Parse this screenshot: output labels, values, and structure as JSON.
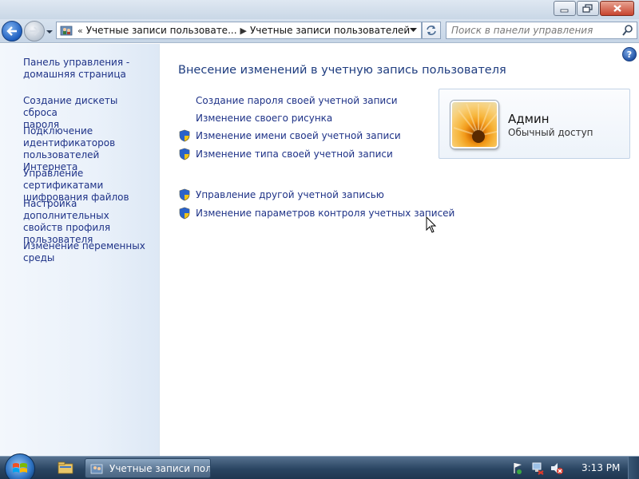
{
  "window": {
    "min_label": "",
    "breadcrumb_lead": "«",
    "breadcrumb": [
      "Учетные записи пользовате...",
      "Учетные записи пользователей"
    ],
    "breadcrumb_sep": "▶",
    "search_placeholder": "Поиск в панели управления"
  },
  "sidebar": {
    "items": [
      "Панель управления -\nдомашняя страница",
      "Создание дискеты сброса\nпароля",
      "Подключение\nидентификаторов\nпользователей Интернета",
      "Управление сертификатами\nшифрования файлов",
      "Настройка дополнительных\nсвойств профиля\nпользователя",
      "Изменение переменных\nсреды"
    ]
  },
  "main": {
    "title": "Внесение изменений в учетную запись пользователя",
    "help": "?",
    "tasks": [
      {
        "label": "Создание пароля своей учетной записи",
        "shield": false
      },
      {
        "label": "Изменение своего рисунка",
        "shield": false
      },
      {
        "label": "Изменение имени своей учетной записи",
        "shield": true
      },
      {
        "label": "Изменение типа своей учетной записи",
        "shield": true
      },
      {
        "label": "Управление другой учетной записью",
        "shield": true
      },
      {
        "label": "Изменение параметров контроля учетных записей",
        "shield": true
      }
    ]
  },
  "user": {
    "name": "Админ",
    "role": "Обычный доступ"
  },
  "taskbar": {
    "active_window": "Учетные записи пол...",
    "clock": "3:13 PM"
  },
  "colors": {
    "link": "#1e3287",
    "title": "#1e3c7f",
    "accent": "#1f5fbf"
  }
}
